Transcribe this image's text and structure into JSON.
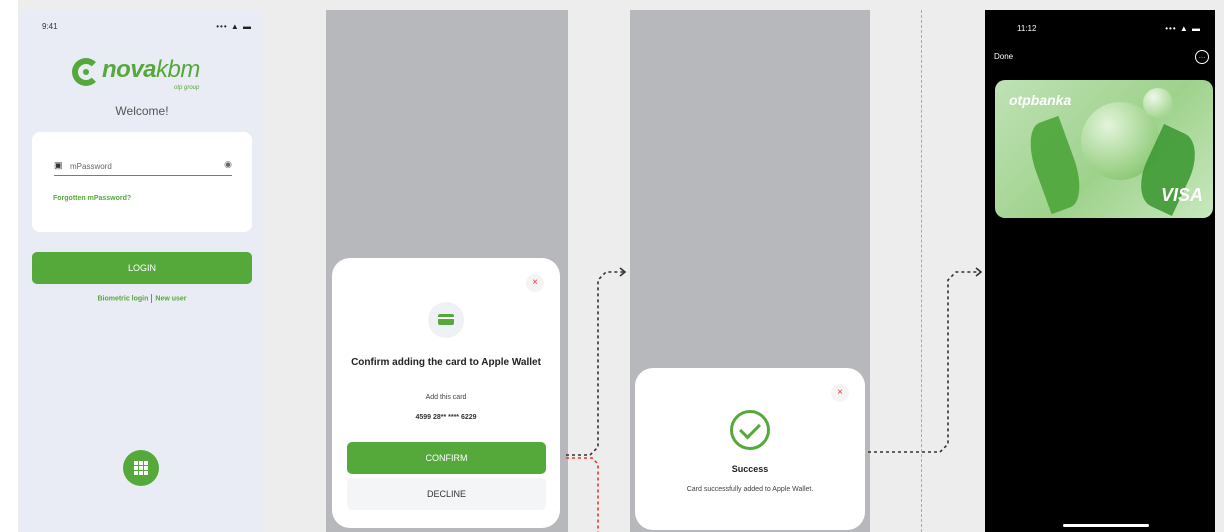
{
  "login_screen": {
    "status_time": "9:41",
    "status_icons": "••• ▲ ▬",
    "logo_text_bold": "nova",
    "logo_text_light": "kbm",
    "logo_tagline": "otp group",
    "welcome": "Welcome!",
    "password_placeholder": "mPassword",
    "forgot_link": "Forgotten mPassword?",
    "login_button": "LOGIN",
    "biometric_link": "Biometric login",
    "new_user_link": "New user"
  },
  "confirm_screen": {
    "title": "Confirm adding the card to Apple Wallet",
    "subtitle": "Add this card",
    "card_number": "4599 28** **** 6229",
    "confirm_button": "CONFIRM",
    "decline_button": "DECLINE",
    "close_glyph": "×"
  },
  "success_screen": {
    "title": "Success",
    "message": "Card successfully added to Apple Wallet.",
    "close_glyph": "×"
  },
  "wallet_screen": {
    "status_time": "11:12",
    "status_icons": "••• ▲ ▬",
    "done": "Done",
    "more_glyph": "…",
    "bank_name": "otpbanka",
    "network": "VISA"
  },
  "colors": {
    "brand_green": "#55a93b",
    "close_red": "#e53935",
    "overlay_gray": "#b7b8bc",
    "flow_black": "#333333",
    "flow_red": "#e53935"
  },
  "icons": [
    "lock-icon",
    "eye-icon",
    "grid-menu-icon",
    "card-icon",
    "close-icon",
    "check-circle-icon",
    "more-icon"
  ]
}
